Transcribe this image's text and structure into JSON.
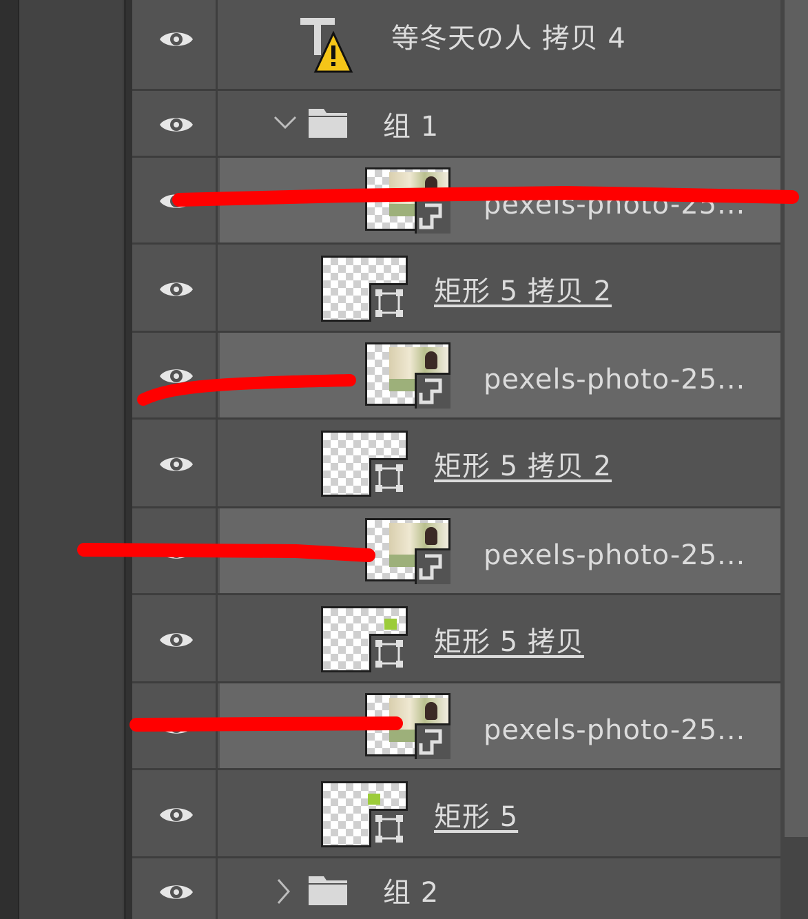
{
  "layers": [
    {
      "label": "等冬天の人 拷贝 4",
      "type": "text",
      "warning": true
    },
    {
      "label": "组 1",
      "type": "group",
      "expanded": true
    },
    {
      "label": "pexels-photo-25...",
      "type": "smart-object",
      "highlighted": true
    },
    {
      "label": "矩形 5 拷贝 2",
      "type": "shape"
    },
    {
      "label": "pexels-photo-25...",
      "type": "smart-object",
      "highlighted": true
    },
    {
      "label": "矩形 5 拷贝 2",
      "type": "shape"
    },
    {
      "label": "pexels-photo-25...",
      "type": "smart-object",
      "highlighted": true
    },
    {
      "label": "矩形 5 拷贝",
      "type": "shape"
    },
    {
      "label": "pexels-photo-25...",
      "type": "smart-object",
      "highlighted": true
    },
    {
      "label": "矩形 5",
      "type": "shape"
    },
    {
      "label": "组 2",
      "type": "group",
      "expanded": false
    }
  ],
  "colors": {
    "annotation_red": "#ff0000",
    "panel": "#535353",
    "highlight": "#676767"
  }
}
